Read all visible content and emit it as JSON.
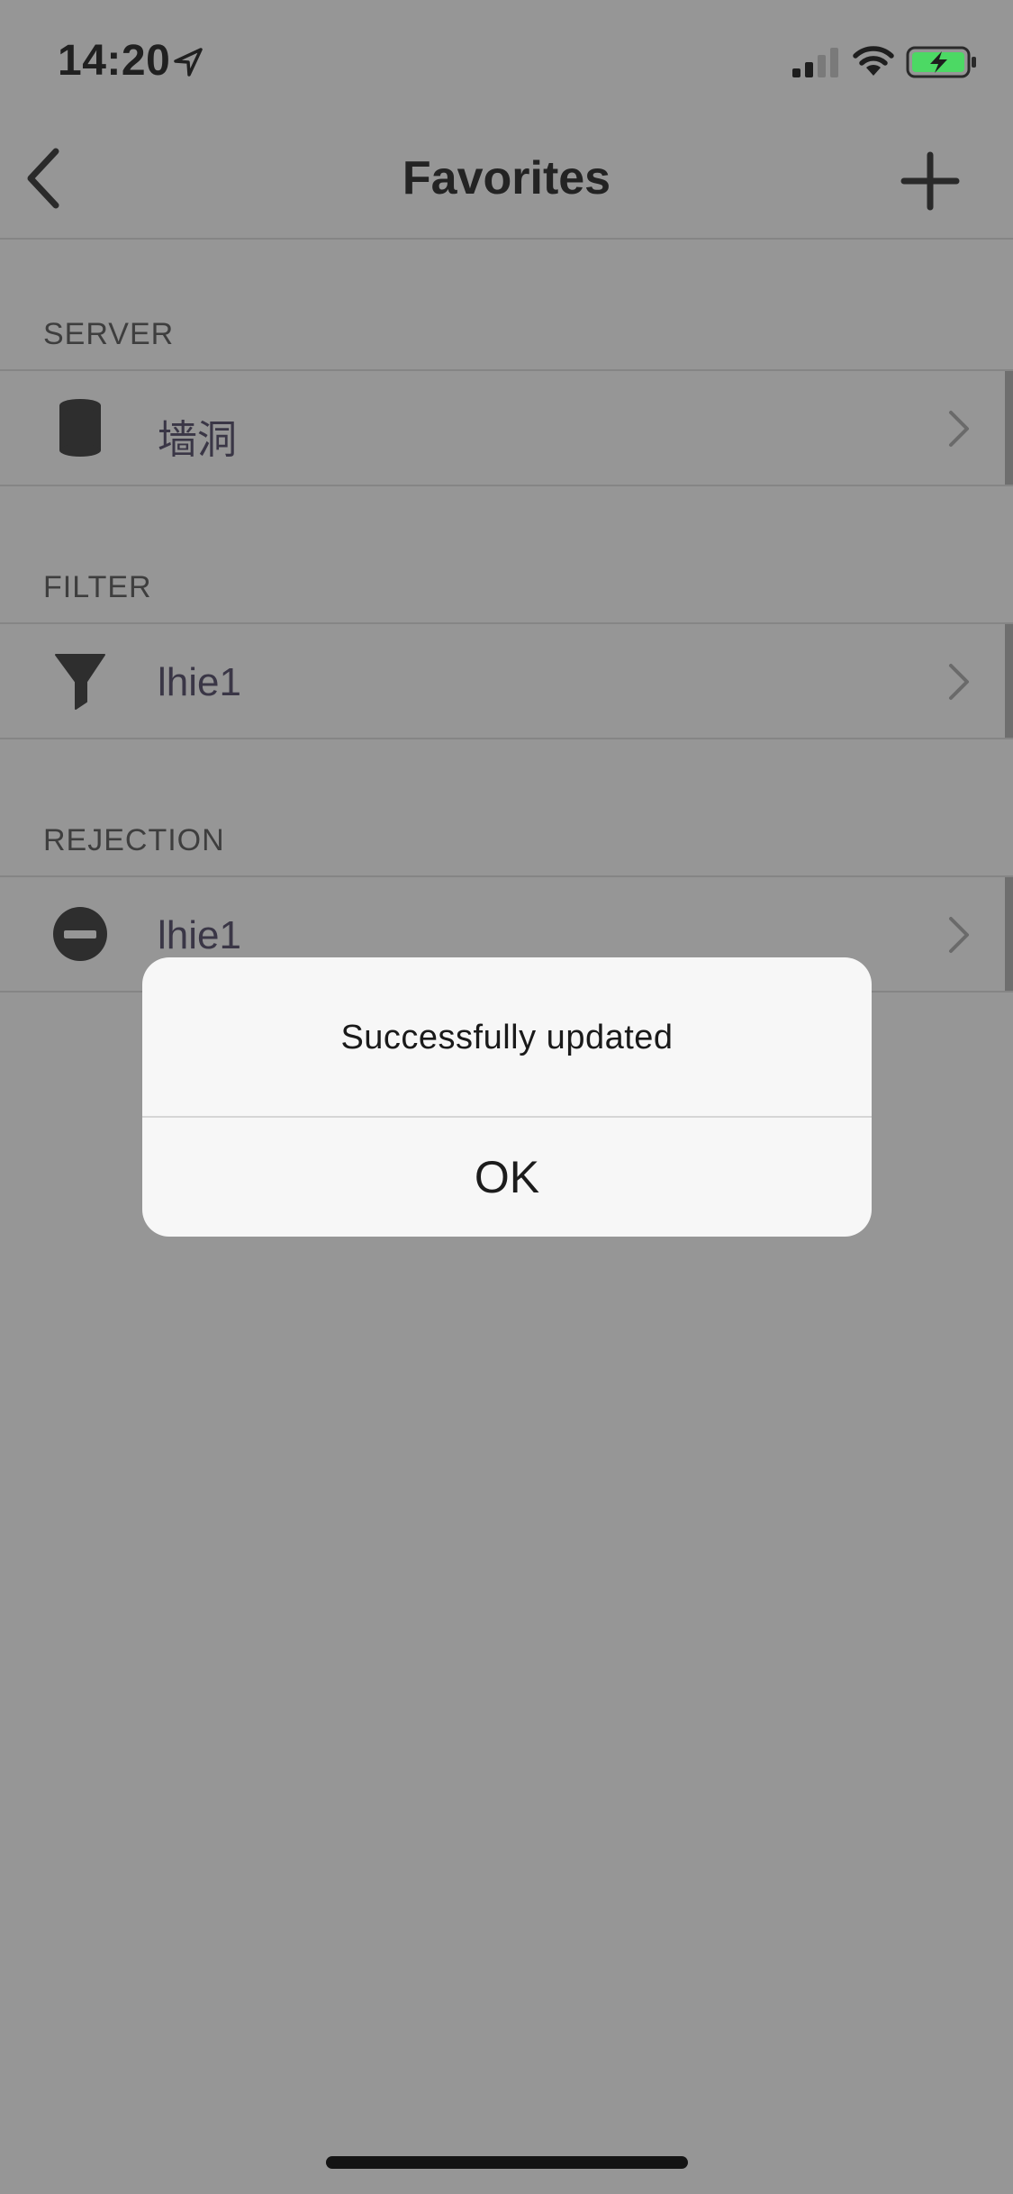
{
  "status_bar": {
    "time": "14:20",
    "location_icon": "location-arrow-icon",
    "signal_icon": "cellular-signal-icon",
    "wifi_icon": "wifi-icon",
    "battery_icon": "battery-charging-icon",
    "battery_color": "#4cd964"
  },
  "nav": {
    "title": "Favorites",
    "back_icon": "chevron-left-icon",
    "add_icon": "plus-icon"
  },
  "sections": [
    {
      "header": "SERVER",
      "row": {
        "label": "墙洞",
        "icon": "database-icon"
      }
    },
    {
      "header": "FILTER",
      "row": {
        "label": "lhie1",
        "icon": "funnel-icon"
      }
    },
    {
      "header": "REJECTION",
      "row": {
        "label": "lhie1",
        "icon": "minus-circle-icon"
      }
    }
  ],
  "alert": {
    "message": "Successfully updated",
    "ok_label": "OK"
  },
  "colors": {
    "dimmed_background": "#969696",
    "alert_background": "#f7f7f7"
  }
}
